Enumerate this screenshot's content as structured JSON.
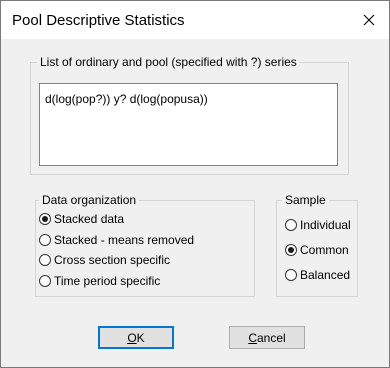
{
  "window": {
    "title": "Pool Descriptive Statistics",
    "close_glyph": "×"
  },
  "series": {
    "label": "List of ordinary and pool (specified with ?) series",
    "value": "d(log(pop?)) y? d(log(popusa))"
  },
  "data_organization": {
    "label": "Data organization",
    "selected": "Stacked data",
    "options": [
      "Stacked data",
      "Stacked - means removed",
      "Cross section specific",
      "Time period specific"
    ]
  },
  "sample": {
    "label": "Sample",
    "selected": "Common",
    "options": [
      "Individual",
      "Common",
      "Balanced"
    ]
  },
  "buttons": {
    "ok_mnemonic": "O",
    "ok_rest": "K",
    "cancel_mnemonic": "C",
    "cancel_rest": "ancel"
  },
  "colors": {
    "accent": "#0078d7",
    "dialog_bg": "#f0f0f0"
  }
}
